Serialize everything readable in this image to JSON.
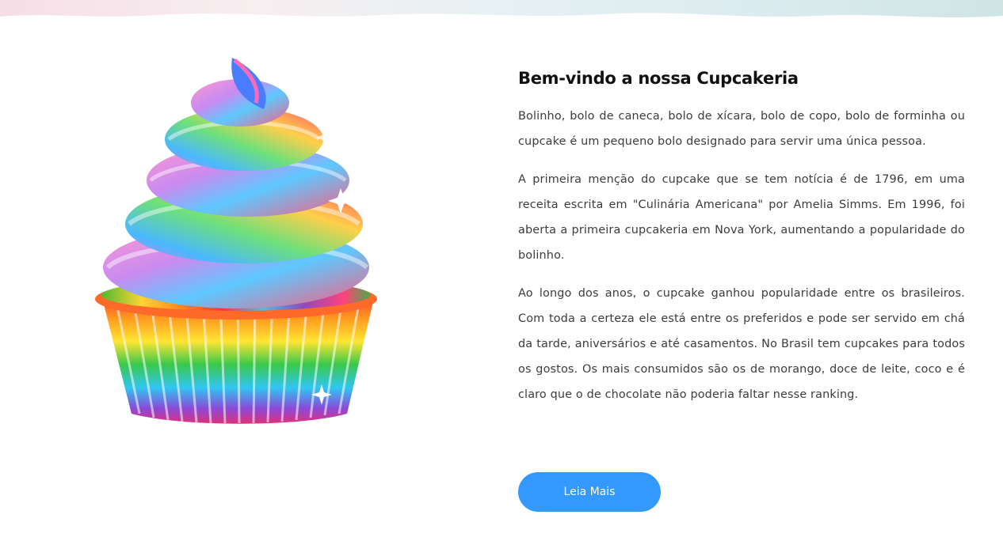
{
  "about": {
    "title": "Bem-vindo a nossa Cupcakeria",
    "paragraphs": [
      "Bolinho, bolo de caneca, bolo de xícara, bolo de copo, bolo de forminha ou cupcake é um pequeno bolo designado para servir uma única pessoa.",
      "A primeira menção do cupcake que se tem notícia é de 1796, em uma receita escrita em \"Culinária Americana\" por Amelia Simms. Em 1996, foi aberta a primeira cupcakeria em Nova York, aumentando a popularidade do bolinho.",
      "Ao longo dos anos, o cupcake ganhou popularidade entre os brasileiros. Com toda a certeza ele está entre os preferidos e pode ser servido em chá da tarde, aniversários e até casamentos. No Brasil tem cupcakes para todos os gostos. Os mais consumidos são os de morango, doce de leite, coco e é claro que o de chocolate não poderia faltar nesse ranking."
    ],
    "button_label": "Leia Mais"
  },
  "image": {
    "subject": "rainbow-cupcake"
  },
  "colors": {
    "accent": "#3399ff",
    "title": "#111111",
    "text": "#3c3c3c"
  }
}
